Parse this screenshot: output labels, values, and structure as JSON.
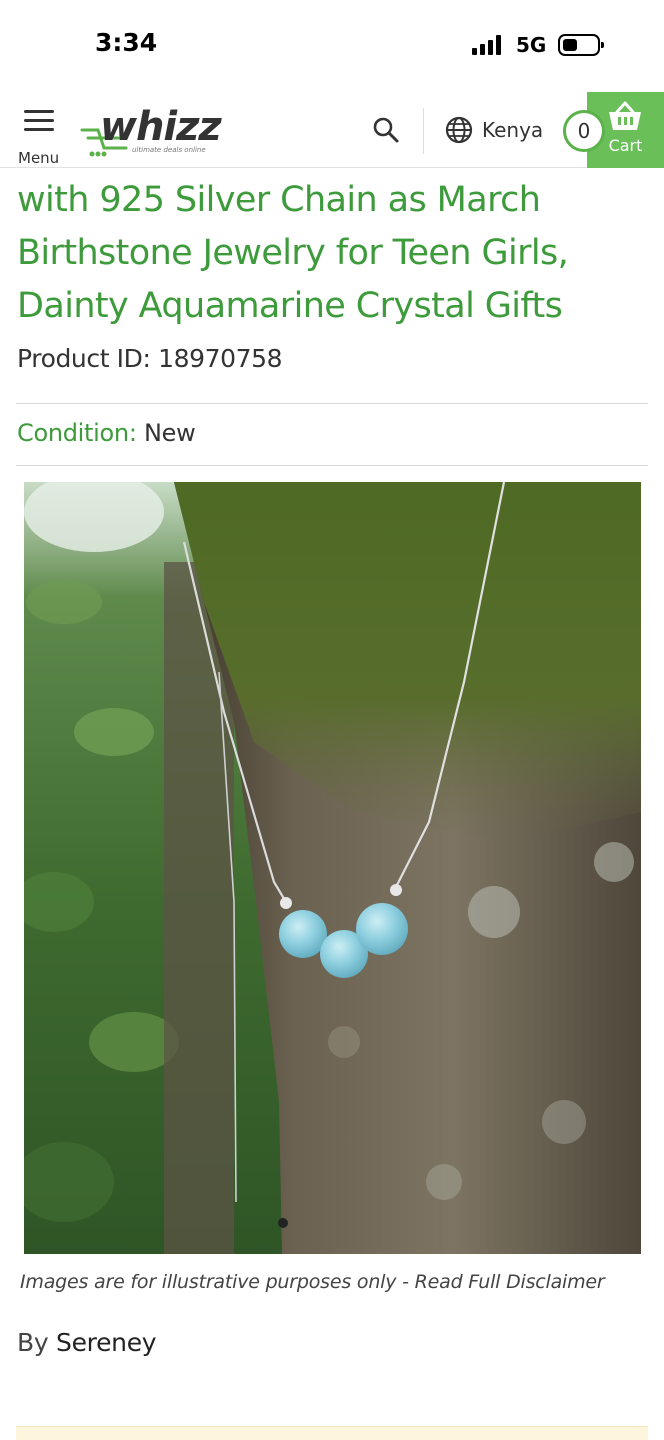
{
  "status_bar": {
    "time": "3:34",
    "network": "5G"
  },
  "header": {
    "menu_label": "Menu",
    "logo_text": "whizz",
    "logo_tagline": "ultimate deals online",
    "country": "Kenya",
    "cart_count": "0",
    "cart_label": "Cart",
    "accent_color": "#6abf59"
  },
  "product": {
    "title": "with 925 Silver Chain as March Birthstone Jewelry for Teen Girls, Dainty Aquamarine Crystal Gifts",
    "id_label": "Product ID:",
    "id_value": "18970758",
    "condition_label": "Condition:",
    "condition_value": "New",
    "image_alt": "Aquamarine crystal bead necklace hanging on mossy tree trunk",
    "carousel_index": 1,
    "carousel_total": 1,
    "disclaimer_text": "Images are for illustrative purposes only - ",
    "disclaimer_link": "Read Full Disclaimer",
    "brand_prefix": "By",
    "brand_name": "Sereney",
    "title_color": "#3d9b3b"
  }
}
